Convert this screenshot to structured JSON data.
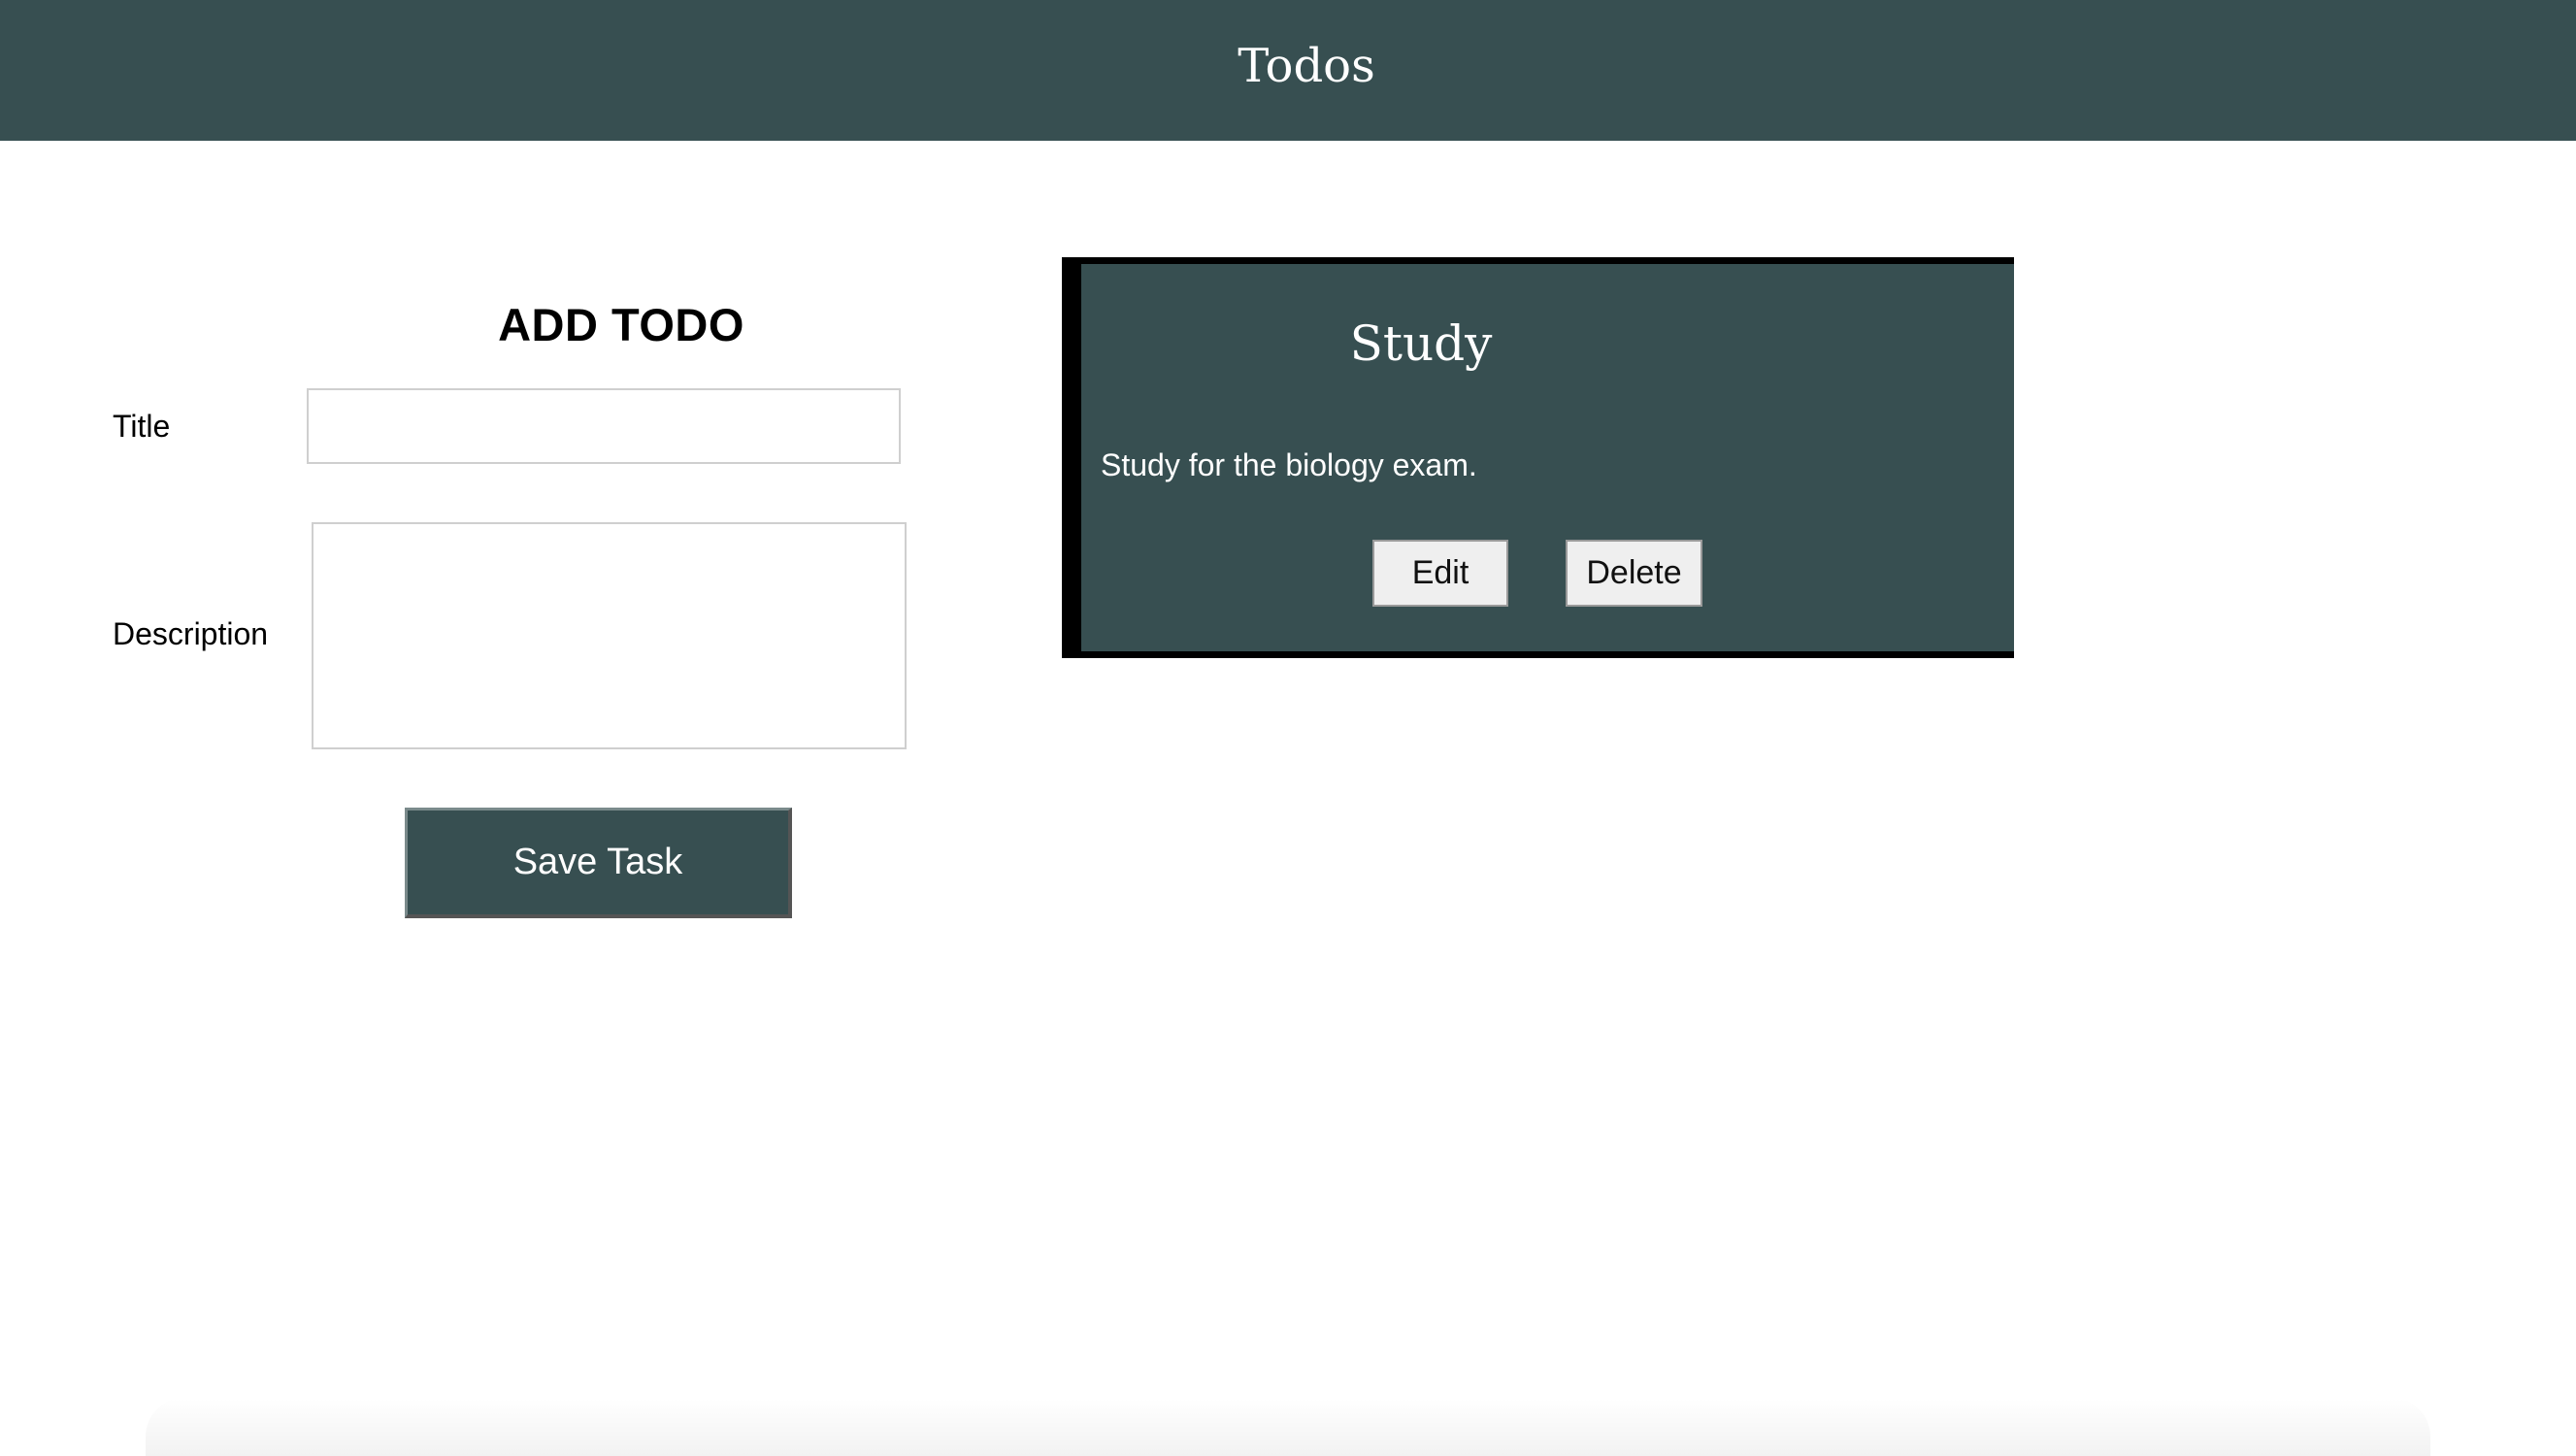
{
  "header": {
    "title": "Todos"
  },
  "form": {
    "heading": "ADD TODO",
    "title_label": "Title",
    "title_value": "",
    "description_label": "Description",
    "description_value": "",
    "save_label": "Save Task"
  },
  "todos": [
    {
      "title": "Study",
      "description": "Study for the biology exam.",
      "edit_label": "Edit",
      "delete_label": "Delete"
    }
  ],
  "colors": {
    "primary": "#374f51",
    "card_border": "#000000",
    "background": "#ffffff"
  }
}
